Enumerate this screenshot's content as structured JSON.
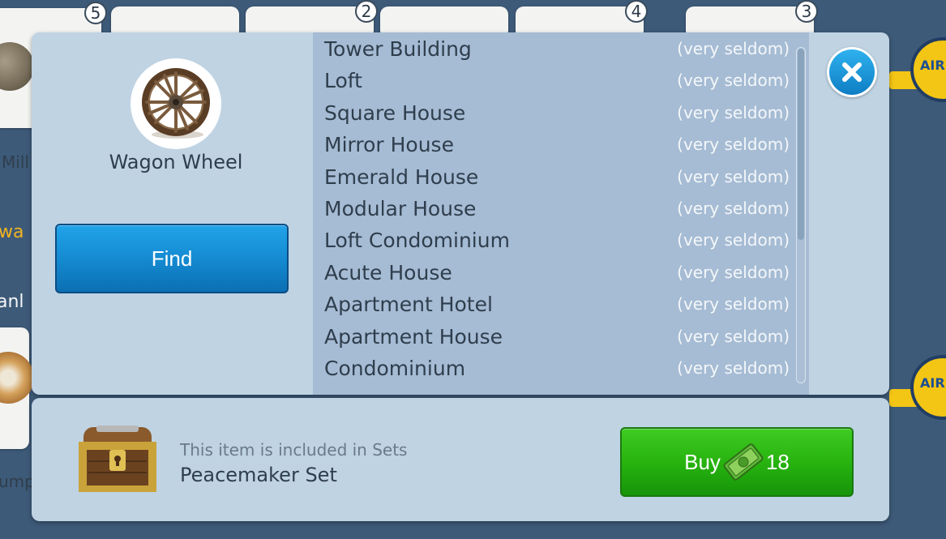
{
  "background": {
    "badges": [
      "5",
      "2",
      "4",
      "3"
    ],
    "partial_texts": [
      "Mill",
      "wa",
      "anl",
      "ump"
    ],
    "air_badge_text": "AIR CI"
  },
  "item": {
    "name": "Wagon Wheel",
    "icon": "wagon-wheel-icon"
  },
  "find_label": "Find",
  "list": [
    {
      "name": "Tower Building",
      "freq": "(very seldom)"
    },
    {
      "name": "Loft",
      "freq": "(very seldom)"
    },
    {
      "name": "Square House",
      "freq": "(very seldom)"
    },
    {
      "name": "Mirror House",
      "freq": "(very seldom)"
    },
    {
      "name": "Emerald House",
      "freq": "(very seldom)"
    },
    {
      "name": "Modular House",
      "freq": "(very seldom)"
    },
    {
      "name": "Loft Condominium",
      "freq": "(very seldom)"
    },
    {
      "name": "Acute House",
      "freq": "(very seldom)"
    },
    {
      "name": "Apartment Hotel",
      "freq": "(very seldom)"
    },
    {
      "name": "Apartment House",
      "freq": "(very seldom)"
    },
    {
      "name": "Condominium",
      "freq": "(very seldom)"
    }
  ],
  "set_info": {
    "caption": "This item is included in Sets",
    "name": "Peacemaker Set",
    "icon": "treasure-chest-icon"
  },
  "buy": {
    "label": "Buy",
    "price": "18",
    "icon": "cash-icon"
  },
  "colors": {
    "panel": "#bfd3e3",
    "list_bg": "#a6bcd4",
    "find_button": "#1488cf",
    "buy_button": "#26b10f",
    "close_button": "#1a96db"
  }
}
